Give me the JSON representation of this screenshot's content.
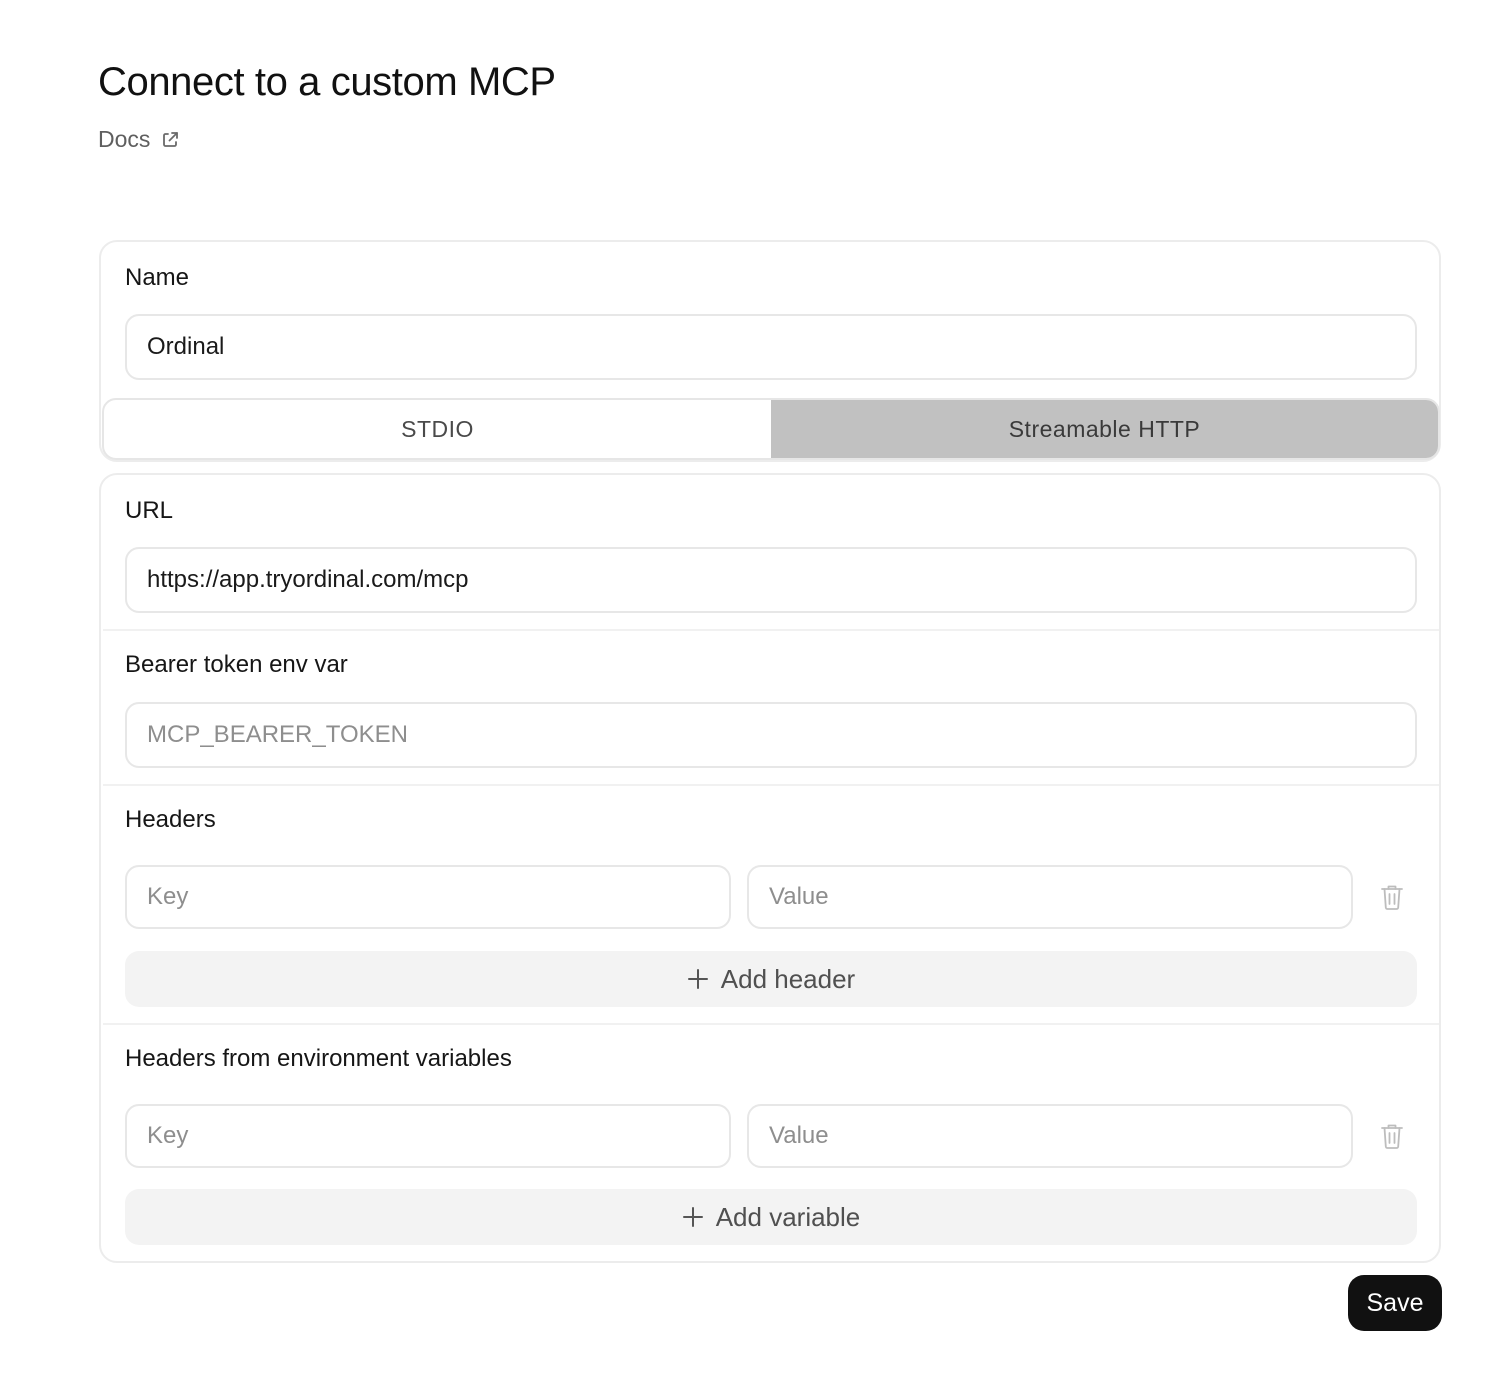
{
  "header": {
    "title": "Connect to a custom MCP",
    "docs_label": "Docs"
  },
  "name_section": {
    "label": "Name",
    "value": "Ordinal"
  },
  "transport_tabs": [
    {
      "label": "STDIO",
      "active": false
    },
    {
      "label": "Streamable HTTP",
      "active": true
    }
  ],
  "url_section": {
    "label": "URL",
    "value": "https://app.tryordinal.com/mcp"
  },
  "bearer_section": {
    "label": "Bearer token env var",
    "placeholder": "MCP_BEARER_TOKEN",
    "value": ""
  },
  "headers_section": {
    "label": "Headers",
    "key_placeholder": "Key",
    "value_placeholder": "Value",
    "add_label": "Add header"
  },
  "env_headers_section": {
    "label": "Headers from environment variables",
    "key_placeholder": "Key",
    "value_placeholder": "Value",
    "add_label": "Add variable"
  },
  "actions": {
    "save_label": "Save"
  },
  "colors": {
    "primary_button": "#111111",
    "active_tab": "#c1c1c1",
    "add_button_bg": "#f3f3f3",
    "border": "#e7e7e7"
  },
  "icons": {
    "docs": "external-link-icon",
    "delete": "trash-icon",
    "add": "plus-icon"
  }
}
